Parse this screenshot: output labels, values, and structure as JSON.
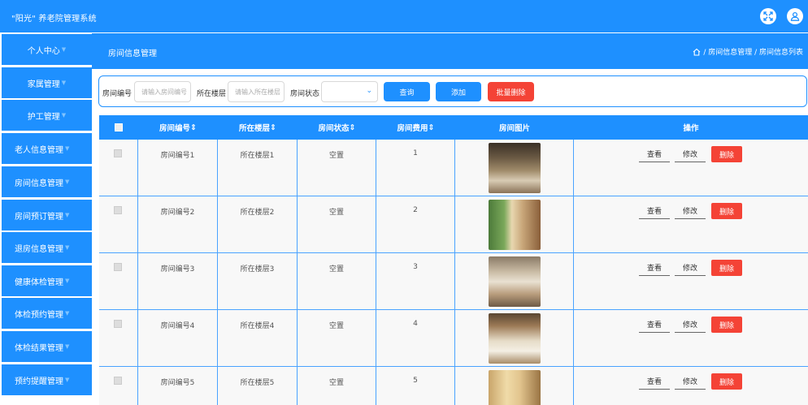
{
  "app": {
    "title": "\"阳光\" 养老院管理系统"
  },
  "icons": {
    "expand": "expand-icon",
    "user": "user-icon",
    "home": "home-icon"
  },
  "colors": {
    "primary": "#1e90ff",
    "danger": "#f44336"
  },
  "sidebar": {
    "items": [
      {
        "label": "个人中心"
      },
      {
        "label": "家属管理"
      },
      {
        "label": "护工管理"
      },
      {
        "label": "老人信息管理"
      },
      {
        "label": "房间信息管理"
      },
      {
        "label": "房间预订管理"
      },
      {
        "label": "退房信息管理"
      },
      {
        "label": "健康体检管理"
      },
      {
        "label": "体检预约管理"
      },
      {
        "label": "体检结果管理"
      },
      {
        "label": "预约提醒管理"
      }
    ]
  },
  "header": {
    "page_title": "房间信息管理",
    "breadcrumb": "/ 房间信息管理 / 房间信息列表"
  },
  "search": {
    "room_no_label": "房间编号",
    "room_no_placeholder": "请输入房间编号",
    "floor_label": "所在楼层",
    "floor_placeholder": "请输入所在楼层",
    "status_label": "房间状态",
    "status_value": "",
    "query_label": "查询",
    "add_label": "添加",
    "batch_delete_label": "批量删除"
  },
  "table": {
    "headers": [
      "房间编号",
      "所在楼层",
      "房间状态",
      "房间费用",
      "房间图片",
      "操作"
    ],
    "rows": [
      {
        "room_no": "房间编号1",
        "floor": "所在楼层1",
        "status": "空置",
        "fee": "1"
      },
      {
        "room_no": "房间编号2",
        "floor": "所在楼层2",
        "status": "空置",
        "fee": "2"
      },
      {
        "room_no": "房间编号3",
        "floor": "所在楼层3",
        "status": "空置",
        "fee": "3"
      },
      {
        "room_no": "房间编号4",
        "floor": "所在楼层4",
        "status": "空置",
        "fee": "4"
      },
      {
        "room_no": "房间编号5",
        "floor": "所在楼层5",
        "status": "空置",
        "fee": "5"
      }
    ],
    "actions": {
      "view": "查看",
      "edit": "修改",
      "delete": "删除"
    }
  }
}
